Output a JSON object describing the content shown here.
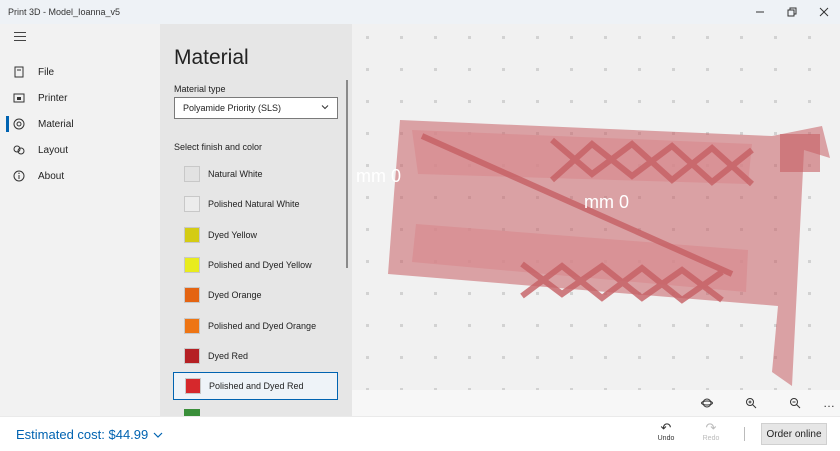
{
  "window": {
    "title": "Print 3D - Model_Ioanna_v5"
  },
  "nav": {
    "items": [
      {
        "label": "File",
        "icon": "file-icon"
      },
      {
        "label": "Printer",
        "icon": "printer-icon"
      },
      {
        "label": "Material",
        "icon": "material-icon",
        "active": true
      },
      {
        "label": "Layout",
        "icon": "layout-icon"
      },
      {
        "label": "About",
        "icon": "info-icon"
      }
    ]
  },
  "material": {
    "heading": "Material",
    "type_label": "Material type",
    "type_value": "Polyamide Priority (SLS)",
    "finish_label": "Select finish and color",
    "options": [
      {
        "label": "Natural White",
        "color": "#e2e2e2"
      },
      {
        "label": "Polished Natural White",
        "color": "#ececec"
      },
      {
        "label": "Dyed Yellow",
        "color": "#d4cc14"
      },
      {
        "label": "Polished and Dyed Yellow",
        "color": "#e8ec1e"
      },
      {
        "label": "Dyed Orange",
        "color": "#e46412"
      },
      {
        "label": "Polished and Dyed Orange",
        "color": "#ee7514"
      },
      {
        "label": "Dyed Red",
        "color": "#b52024"
      },
      {
        "label": "Polished and Dyed Red",
        "color": "#d6282c",
        "selected": true
      }
    ]
  },
  "viewport": {
    "measure_labels": [
      "mm 0",
      "mm 0"
    ],
    "model_color": "#c65f64"
  },
  "bottom": {
    "estimated_cost": "Estimated cost: $44.99",
    "undo": "Undo",
    "redo": "Redo",
    "order": "Order online"
  }
}
